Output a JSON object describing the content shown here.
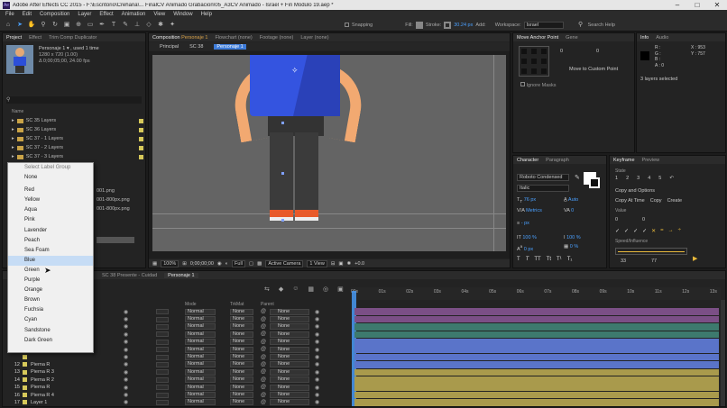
{
  "window": {
    "title": "Adobe After Effects CC 2015 - F:\\Escritorio\\Crehana\\... FinalCV Animado Grabacion\\05_A3CV Animado - Israel + Fin Modulo 19.aep *",
    "minimize": "–",
    "maximize": "□",
    "close": "✕"
  },
  "menu": [
    "File",
    "Edit",
    "Composition",
    "Layer",
    "Effect",
    "Animation",
    "View",
    "Window",
    "Help"
  ],
  "toolbar": {
    "snapping_label": "Snapping",
    "fill_label": "Fill:",
    "stroke_label": "Stroke:",
    "stroke_value": "30.24 px",
    "add_label": "Add:",
    "workspace_label": "Workspace:",
    "workspace_value": "Israel",
    "search_placeholder": "Search Help"
  },
  "project_panel": {
    "tabs": [
      "Project",
      "Effect",
      "Trim Comp Duplicator"
    ],
    "selected_name": "Personaje 1 ▾ , used 1 time",
    "selected_info1": "1280 x 720 (1.00)",
    "selected_info2": "Δ 0;00;05;00, 24.00 fps",
    "search_icon": "search-icon",
    "name_header": "Name",
    "folders": [
      "SC 35 Layers",
      "SC 36 Layers",
      "SC 37 - 1 Layers",
      "SC 37 - 2 Layers",
      "SC 37 - 3 Layers"
    ],
    "partial_items": [
      "001.png",
      "001-800px.png",
      "001-800px.png"
    ]
  },
  "label_menu": {
    "header": "Select Label Group",
    "items": [
      "None",
      "Red",
      "Yellow",
      "Aqua",
      "Pink",
      "Lavender",
      "Peach",
      "Sea Foam",
      "Blue",
      "Green",
      "Purple",
      "Orange",
      "Brown",
      "Fuchsia",
      "Cyan",
      "Sandstone",
      "Dark Green"
    ],
    "highlighted": "Blue"
  },
  "comp_panel": {
    "tab_prefix": "Composition",
    "tab_name": "Personaje 1",
    "other_tabs": [
      "Flowchart (none)",
      "Footage (none)",
      "Layer (none)"
    ],
    "breadcrumbs": [
      "Principal",
      "SC 38",
      "Personaje 1"
    ],
    "footer": {
      "zoom": "100%",
      "timecode": "0;00;00;00",
      "quality": "Full",
      "camera": "Active Camera",
      "views": "1 View",
      "offset": "+0.0"
    }
  },
  "move_anchor": {
    "tabs": [
      "Move Anchor Point",
      "Gene"
    ],
    "button_label": "Move to Custom Point",
    "checkbox_label": "Ignore Masks",
    "x_val": "0",
    "y_val": "0"
  },
  "info_panel": {
    "tabs": [
      "Info",
      "Audio"
    ],
    "r": "R :",
    "g": "G :",
    "b": "B :",
    "a": "A : 0",
    "x": "X : 953",
    "y": "Y : 757",
    "selected": "3 layers selected"
  },
  "character": {
    "tabs": [
      "Character",
      "Paragraph"
    ],
    "font": "Roboto Condensed",
    "style": "Italic",
    "size": "76 px",
    "leading": "Auto",
    "tracking_a": "Metrics",
    "tracking_b": "0",
    "stroke_w": "- px",
    "vscale": "100 %",
    "hscale": "100 %",
    "baseline": "0 px",
    "tsume": "0 %"
  },
  "keyframe_panel": {
    "tabs": [
      "Keyframe",
      "Preview"
    ],
    "state_label": "State",
    "copy_options": "Copy and Options",
    "copy_at_time": "Copy At Time",
    "copy": "Copy",
    "create": "Create",
    "value_label": "Value",
    "value_a": "0",
    "value_b": "0",
    "speed_label": "Speed/Influence",
    "speed_a": "33",
    "speed_b": "77",
    "state_nums": [
      "1",
      "2",
      "3",
      "4",
      "5"
    ]
  },
  "timeline": {
    "tabs": [
      "SC 38 Presente - Cuidad",
      "Personaje 1"
    ],
    "ruler": [
      "00s",
      "01s",
      "02s",
      "03s",
      "04s",
      "05s",
      "06s",
      "07s",
      "08s",
      "09s",
      "10s",
      "11s",
      "12s",
      "13s"
    ],
    "col_mode": "Mode",
    "col_trk": "TrkMat",
    "col_parent": "Parent",
    "layers": [
      {
        "num": "",
        "name": "",
        "mode": "Normal",
        "trk": "None",
        "parent": "None",
        "color": "#7b4f86"
      },
      {
        "num": "",
        "name": "",
        "mode": "Normal",
        "trk": "None",
        "parent": "None",
        "color": "#7b4f86"
      },
      {
        "num": "",
        "name": "",
        "mode": "Normal",
        "trk": "None",
        "parent": "None",
        "color": "#3d7a6e"
      },
      {
        "num": "",
        "name": "",
        "mode": "Normal",
        "trk": "None",
        "parent": "None",
        "color": "#3d7a6e"
      },
      {
        "num": "",
        "name": "",
        "mode": "Normal",
        "trk": "None",
        "parent": "None",
        "color": "#5a74c9"
      },
      {
        "num": "",
        "name": "",
        "mode": "Normal",
        "trk": "None",
        "parent": "None",
        "color": "#5a74c9"
      },
      {
        "num": "",
        "name": "",
        "mode": "Normal",
        "trk": "None",
        "parent": "None",
        "color": "#5a74c9"
      },
      {
        "num": "12",
        "name": "Pierna R",
        "mode": "Normal",
        "trk": "None",
        "parent": "None",
        "color": "#5a74c9"
      },
      {
        "num": "13",
        "name": "Pierna R 3",
        "mode": "Normal",
        "trk": "None",
        "parent": "None",
        "color": "#a99a4c"
      },
      {
        "num": "14",
        "name": "Pierna R 2",
        "mode": "Normal",
        "trk": "None",
        "parent": "None",
        "color": "#a99a4c"
      },
      {
        "num": "15",
        "name": "Pierna R",
        "mode": "Normal",
        "trk": "None",
        "parent": "None",
        "color": "#a99a4c"
      },
      {
        "num": "16",
        "name": "Pierna R 4",
        "mode": "Normal",
        "trk": "None",
        "parent": "None",
        "color": "#a99a4c"
      },
      {
        "num": "17",
        "name": "Layer 1",
        "mode": "Normal",
        "trk": "None",
        "parent": "None",
        "color": "#a99a4c"
      }
    ]
  }
}
